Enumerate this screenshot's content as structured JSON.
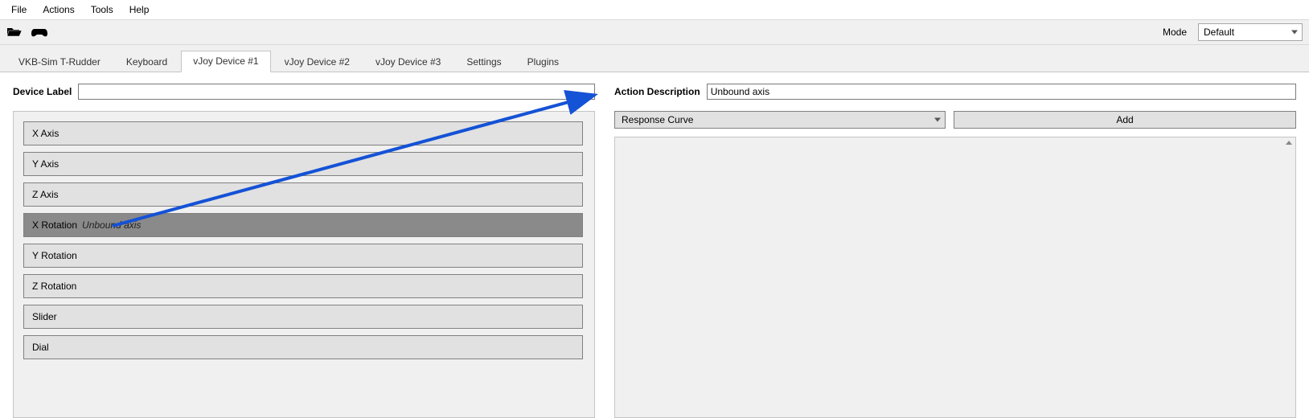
{
  "menu": {
    "file": "File",
    "actions": "Actions",
    "tools": "Tools",
    "help": "Help"
  },
  "toolbar": {
    "mode_label": "Mode",
    "mode_value": "Default"
  },
  "tabs": [
    {
      "label": "VKB-Sim T-Rudder"
    },
    {
      "label": "Keyboard"
    },
    {
      "label": "vJoy Device #1"
    },
    {
      "label": "vJoy Device #2"
    },
    {
      "label": "vJoy Device #3"
    },
    {
      "label": "Settings"
    },
    {
      "label": "Plugins"
    }
  ],
  "active_tab_index": 2,
  "left": {
    "device_label_text": "Device Label",
    "device_label_value": "",
    "axes": [
      {
        "name": "X Axis",
        "sub": ""
      },
      {
        "name": "Y Axis",
        "sub": ""
      },
      {
        "name": "Z Axis",
        "sub": ""
      },
      {
        "name": "X Rotation",
        "sub": "Unbound axis"
      },
      {
        "name": "Y Rotation",
        "sub": ""
      },
      {
        "name": "Z Rotation",
        "sub": ""
      },
      {
        "name": "Slider",
        "sub": ""
      },
      {
        "name": "Dial",
        "sub": ""
      }
    ],
    "selected_axis_index": 3
  },
  "right": {
    "action_desc_label": "Action Description",
    "action_desc_value": "Unbound axis",
    "combo_value": "Response Curve",
    "add_button": "Add"
  }
}
